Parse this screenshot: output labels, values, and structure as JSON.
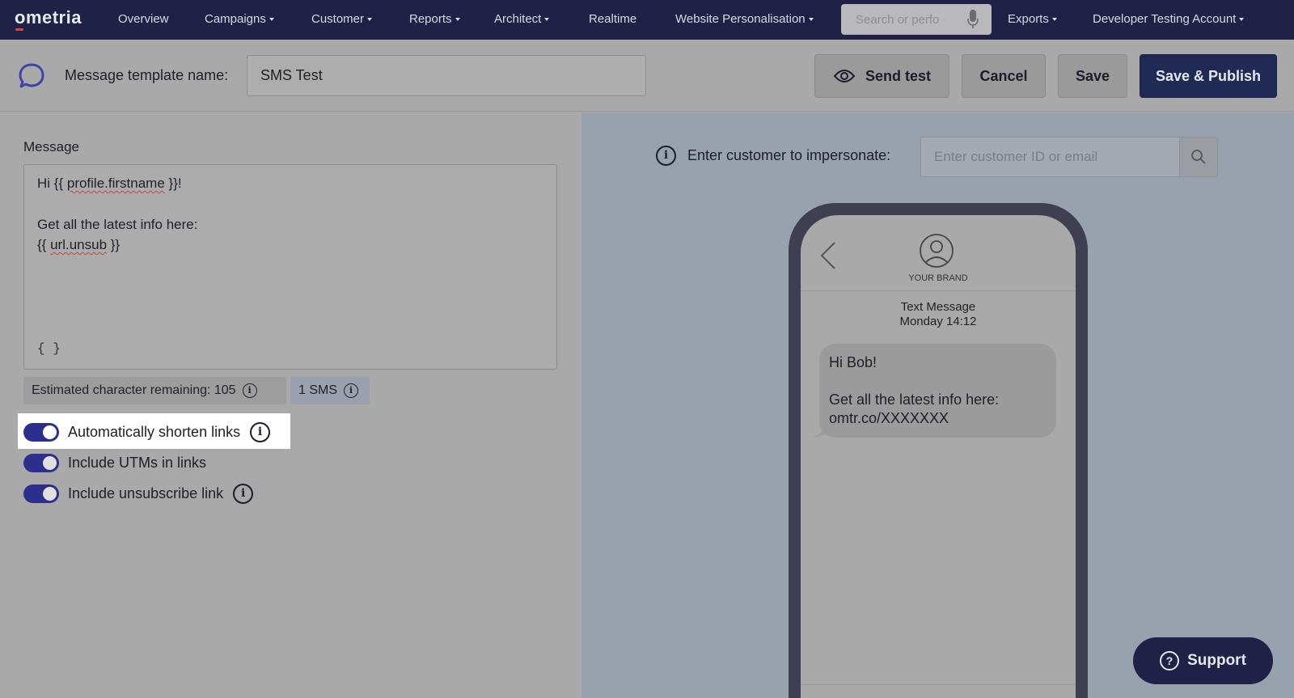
{
  "nav": {
    "logo": "ometria",
    "items": [
      {
        "label": "Overview",
        "dropdown": false
      },
      {
        "label": "Campaigns",
        "dropdown": true
      },
      {
        "label": "Customer",
        "dropdown": true
      },
      {
        "label": "Reports",
        "dropdown": true
      },
      {
        "label": "Architect",
        "dropdown": true
      },
      {
        "label": "Realtime",
        "dropdown": false
      },
      {
        "label": "Website Personalisation",
        "dropdown": true
      }
    ],
    "search_placeholder": "Search or perfo",
    "exports": "Exports",
    "account": "Developer Testing Account"
  },
  "header": {
    "template_name_label": "Message template name:",
    "template_name_value": "SMS Test",
    "send_test": "Send test",
    "cancel": "Cancel",
    "save": "Save",
    "save_publish": "Save & Publish"
  },
  "editor": {
    "message_label": "Message",
    "lines": {
      "l1_pre": "Hi {{ ",
      "l1_var": "profile.firstname",
      "l1_post": " }}!",
      "l2": "Get all the latest info here:",
      "l3_pre": "{{ ",
      "l3_var": "url.unsub",
      "l3_post": " }}"
    },
    "braces": "{ }",
    "estimated_chars": "Estimated character remaining: 105",
    "sms_count": "1 SMS",
    "toggles": [
      {
        "label": "Automatically shorten links",
        "on": true
      },
      {
        "label": "Include UTMs in links",
        "on": true
      },
      {
        "label": "Include unsubscribe link",
        "on": true
      }
    ]
  },
  "preview": {
    "impersonate_label": "Enter customer to impersonate:",
    "impersonate_placeholder": "Enter customer ID or email",
    "brand": "YOUR BRAND",
    "msg_type": "Text Message",
    "msg_time": "Monday 14:12",
    "bubble": {
      "line1": "Hi Bob!",
      "line2": "Get all the latest info here:",
      "line3": "omtr.co/XXXXXXX"
    }
  },
  "support": "Support",
  "colors": {
    "nav_bg": "#1f2246",
    "primary_button": "#1f2b55",
    "toggle_on": "#2d2f8c",
    "overlay_left": "#a9a9a9",
    "overlay_right": "#97a2ae"
  }
}
